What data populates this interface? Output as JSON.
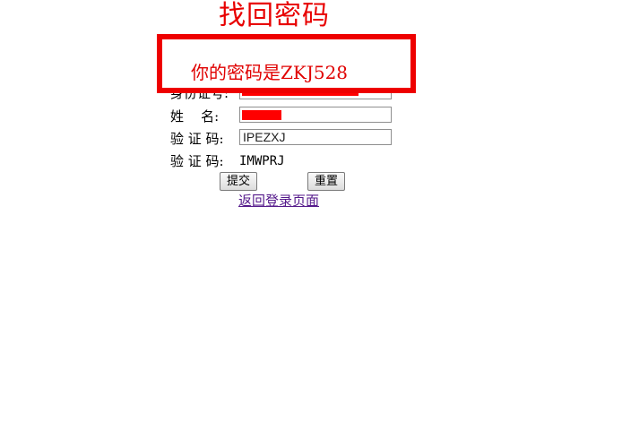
{
  "page": {
    "title": "找回密码"
  },
  "form": {
    "id_label": "身份证号:",
    "name_label": "姓    名:",
    "captcha_input_label": "验 证 码:",
    "captcha_input_value": "IPEZXJ",
    "captcha_display_label": "验 证 码:",
    "captcha_display_value": "IMWPRJ",
    "submit_label": "提交",
    "reset_label": "重置",
    "back_link": "返回登录页面"
  },
  "dialog": {
    "message": "你的密码是ZKJ528"
  },
  "colors": {
    "title": "#e80000",
    "dialog_border": "#ee0000",
    "redaction": "#ff0000",
    "link": "#551a8b"
  }
}
